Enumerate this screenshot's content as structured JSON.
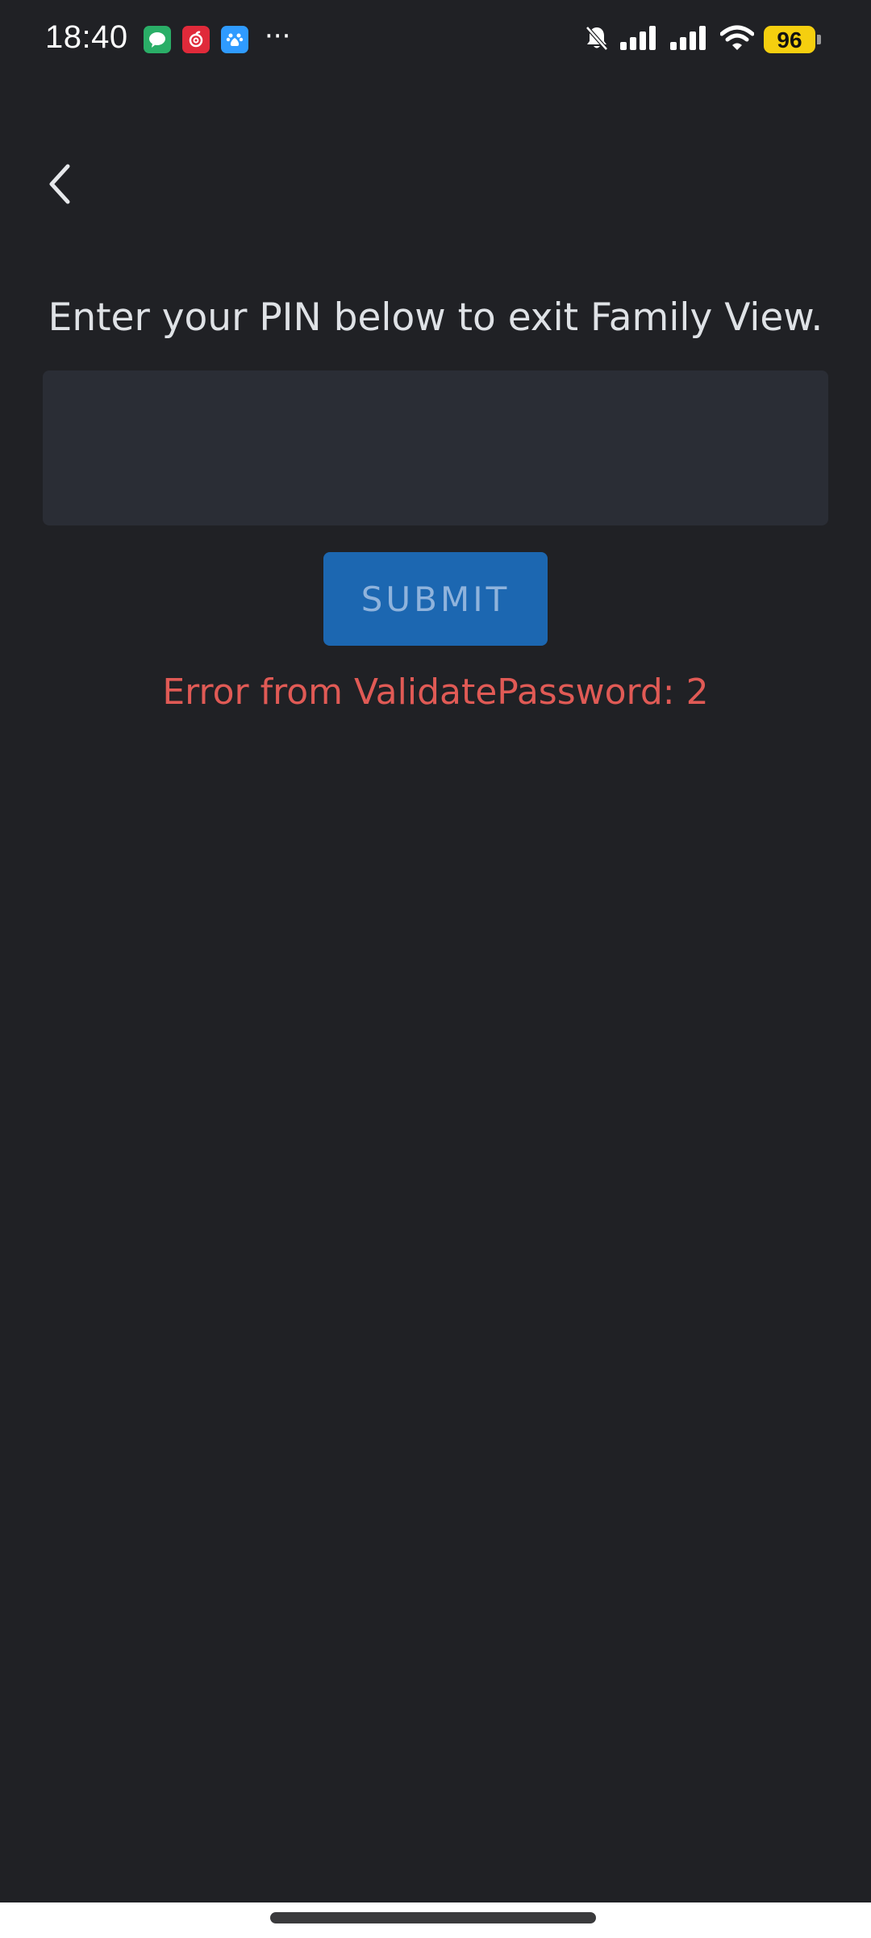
{
  "status_bar": {
    "time": "18:40",
    "battery": "96",
    "more": "···",
    "icons": [
      "wechat-icon",
      "netease-music-icon",
      "baidu-icon",
      "mute-bell-icon",
      "signal-icon",
      "signal-icon",
      "wifi-icon",
      "battery-icon"
    ]
  },
  "header": {
    "back_icon": "chevron-left-icon"
  },
  "main": {
    "prompt": "Enter your PIN below to exit Family View.",
    "pin_value": "",
    "submit_label": "SUBMIT",
    "error": "Error from ValidatePassword: 2"
  },
  "colors": {
    "background": "#202125",
    "input_bg": "#2a2d35",
    "button_bg": "#1c67b1",
    "button_text": "#8fb3dc",
    "error": "#e05a55",
    "battery_badge": "#f5cf0f"
  }
}
